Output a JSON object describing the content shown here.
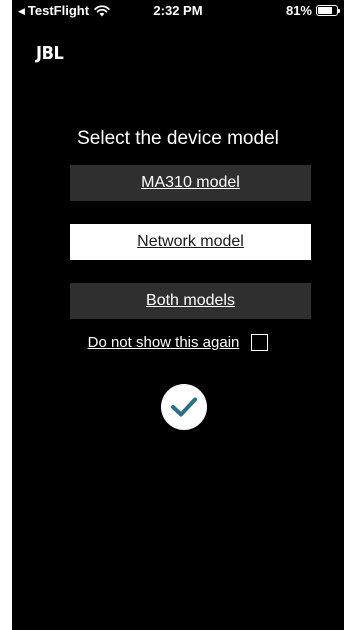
{
  "status_bar": {
    "back_app": "TestFlight",
    "time": "2:32 PM",
    "battery_percent": "81%",
    "battery_level": 0.81,
    "icons": [
      "back-arrow-icon",
      "wifi-icon",
      "battery-icon"
    ]
  },
  "logo": {
    "text": "JBL"
  },
  "main": {
    "title": "Select the device model",
    "options": [
      {
        "label": "MA310 model",
        "selected": false
      },
      {
        "label": "Network model",
        "selected": true
      },
      {
        "label": "Both models",
        "selected": false
      }
    ],
    "dont_show_again": {
      "label": "Do not show this again",
      "checked": false
    },
    "confirm_icon": "checkmark-icon"
  },
  "colors": {
    "background": "#000000",
    "option_dark": "#2f2f2f",
    "option_selected": "#ffffff",
    "accent_check": "#2b6e86"
  }
}
